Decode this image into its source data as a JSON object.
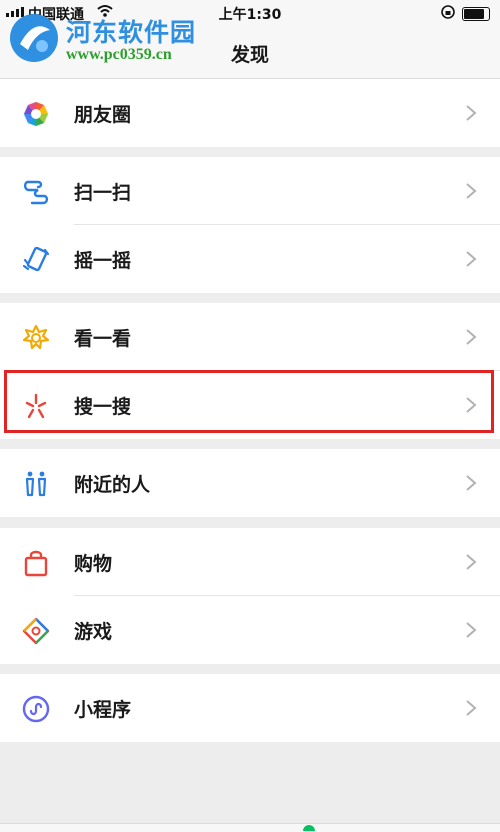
{
  "status": {
    "carrier": "中国联通",
    "time": "上午1:30"
  },
  "nav": {
    "title": "发现"
  },
  "watermark": {
    "title": "河东软件园",
    "url": "www.pc0359.cn"
  },
  "groups": [
    {
      "items": [
        {
          "label": "朋友圈",
          "icon": "moments-icon"
        }
      ]
    },
    {
      "items": [
        {
          "label": "扫一扫",
          "icon": "scan-icon"
        },
        {
          "label": "摇一摇",
          "icon": "shake-icon"
        }
      ]
    },
    {
      "items": [
        {
          "label": "看一看",
          "icon": "top-stories-icon"
        },
        {
          "label": "搜一搜",
          "icon": "search-icon",
          "highlighted": true
        }
      ]
    },
    {
      "items": [
        {
          "label": "附近的人",
          "icon": "people-nearby-icon"
        }
      ]
    },
    {
      "items": [
        {
          "label": "购物",
          "icon": "shopping-bag-icon"
        },
        {
          "label": "游戏",
          "icon": "games-icon"
        }
      ]
    },
    {
      "items": [
        {
          "label": "小程序",
          "icon": "mini-programs-icon"
        }
      ]
    }
  ],
  "colors": {
    "highlight": "#e02424",
    "accent": "#07c160",
    "watermark_title": "#2f8fe0",
    "watermark_url": "#2e9f2e"
  }
}
